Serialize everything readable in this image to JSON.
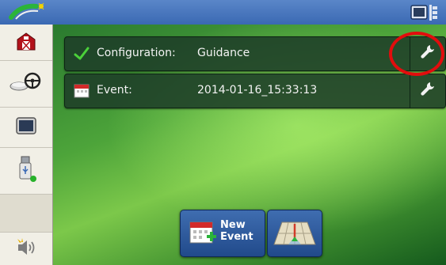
{
  "topbar": {
    "logo_icon": "gps-satellite-logo-icon",
    "display_menu_icon": "display-menu-icon"
  },
  "sidebar": {
    "items": [
      {
        "icon": "farm-barn-icon"
      },
      {
        "icon": "steering-wheel-icon"
      },
      {
        "icon": "display-screen-icon"
      },
      {
        "icon": "usb-drive-icon"
      },
      {
        "icon": "empty"
      },
      {
        "icon": "alerts-sound-icon"
      }
    ]
  },
  "rows": [
    {
      "icon": "checkmark-icon",
      "label": "Configuration:",
      "value": "Guidance",
      "action_icon": "wrench-icon"
    },
    {
      "icon": "calendar-icon",
      "label": "Event:",
      "value": "2014-01-16_15:33:13",
      "action_icon": "wrench-icon"
    }
  ],
  "buttons": {
    "new_event_line1": "New",
    "new_event_line2": "Event",
    "field_view_icon": "field-view-icon"
  },
  "colors": {
    "highlight_circle": "#e20d0d",
    "topbar": "#3a69b3",
    "row_bg": "#1e3e28",
    "check": "#4bd13a"
  }
}
